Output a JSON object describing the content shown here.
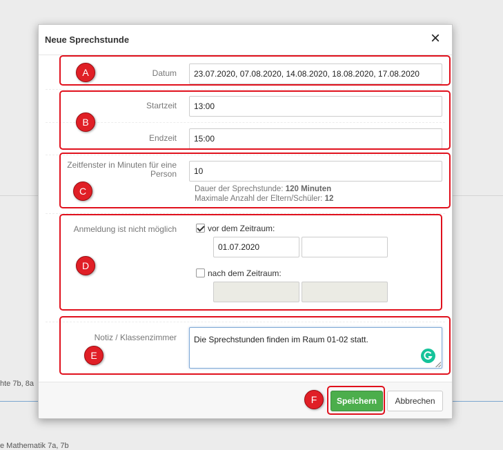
{
  "background": {
    "left_text_1": "hte 7b, 8a",
    "left_text_2": "e  Mathematik 7a, 7b"
  },
  "modal": {
    "title": "Neue Sprechstunde",
    "close_icon": "×"
  },
  "form": {
    "datum": {
      "label": "Datum",
      "value": "23.07.2020, 07.08.2020, 14.08.2020, 18.08.2020, 17.08.2020"
    },
    "startzeit": {
      "label": "Startzeit",
      "value": "13:00"
    },
    "endzeit": {
      "label": "Endzeit",
      "value": "15:00"
    },
    "zeitfenster": {
      "label": "Zeitfenster in Minuten für eine Person",
      "value": "10",
      "help_duration_prefix": "Dauer der Sprechstunde:",
      "help_duration_value": "120 Minuten",
      "help_max_prefix": "Maximale Anzahl der Eltern/Schüler:",
      "help_max_value": "12"
    },
    "anmeldung": {
      "label": "Anmeldung ist nicht möglich",
      "before": {
        "label": "vor dem Zeitraum:",
        "checked": true,
        "date": "01.07.2020",
        "time": ""
      },
      "after": {
        "label": "nach dem Zeitraum:",
        "checked": false,
        "date": "",
        "time": ""
      }
    },
    "notiz": {
      "label": "Notiz / Klassenzimmer",
      "value": "Die Sprechstunden finden im Raum 01-02 statt."
    }
  },
  "footer": {
    "save_label": "Speichern",
    "cancel_label": "Abbrechen"
  },
  "annotations": [
    "A",
    "B",
    "C",
    "D",
    "E",
    "F"
  ],
  "colors": {
    "annotation_red": "#e0101c",
    "save_green": "#4cae4c",
    "grammarly_green": "#15c39a"
  }
}
